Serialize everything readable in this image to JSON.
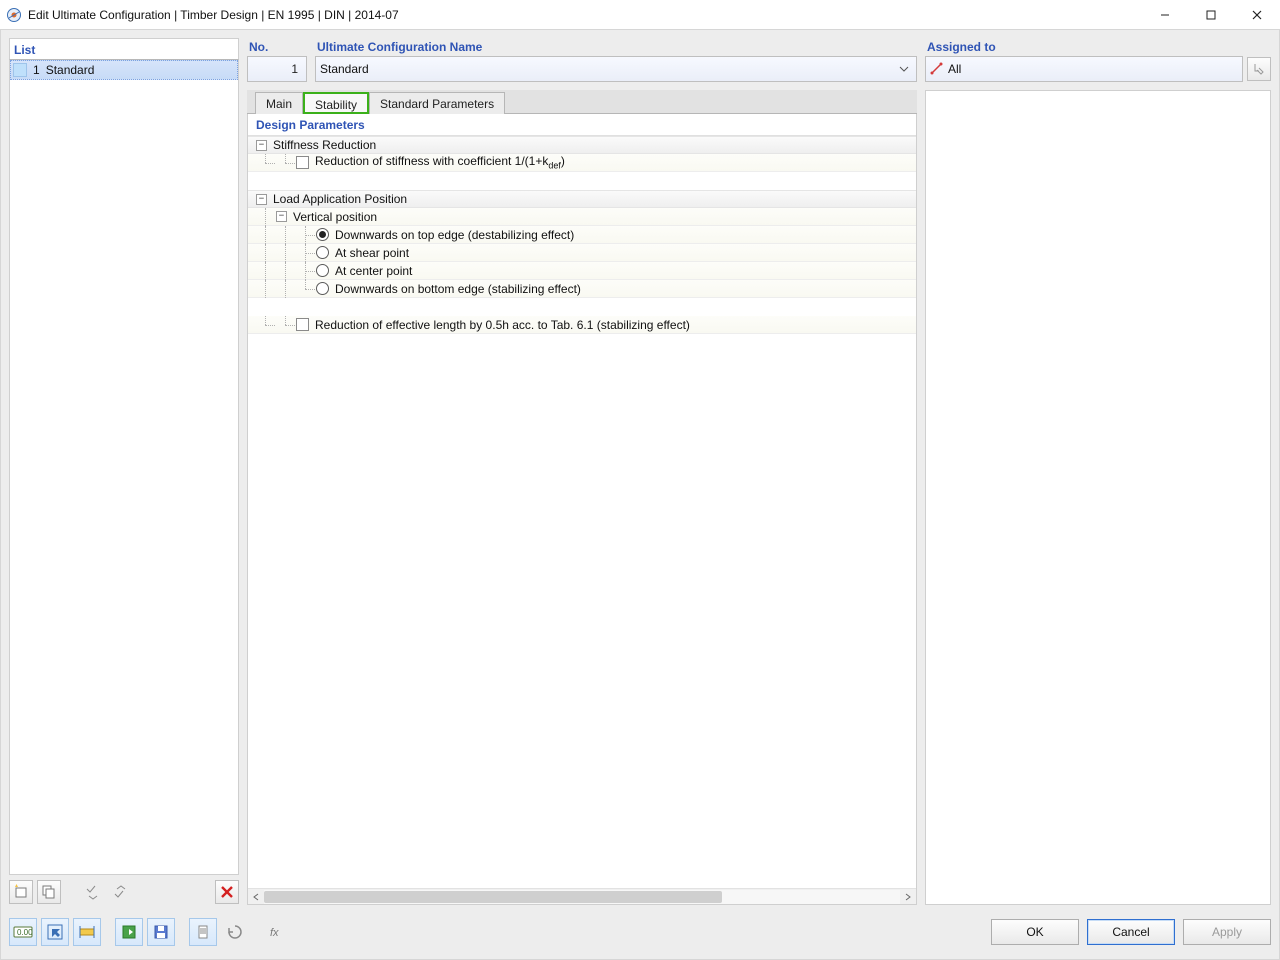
{
  "title": "Edit Ultimate Configuration | Timber Design | EN 1995 | DIN | 2014-07",
  "left": {
    "header": "List",
    "item_no": "1",
    "item_name": "Standard"
  },
  "fields": {
    "no_label": "No.",
    "no_value": "1",
    "name_label": "Ultimate Configuration Name",
    "name_value": "Standard",
    "assigned_label": "Assigned to",
    "assigned_value": "All"
  },
  "tabs": {
    "main": "Main",
    "stability": "Stability",
    "stdparams": "Standard Parameters"
  },
  "params": {
    "heading": "Design Parameters",
    "stiffness_section": "Stiffness Reduction",
    "stiffness_row_pre": "Reduction of stiffness with coefficient 1/(1+k",
    "stiffness_row_sub": "def",
    "stiffness_row_post": ")",
    "load_section": "Load Application Position",
    "vertical_label": "Vertical position",
    "opt1": "Downwards on top edge (destabilizing effect)",
    "opt2": "At shear point",
    "opt3": "At center point",
    "opt4": "Downwards on bottom edge (stabilizing effect)",
    "reduce_len": "Reduction of effective length by 0.5h acc. to Tab. 6.1 (stabilizing effect)"
  },
  "buttons": {
    "ok": "OK",
    "cancel": "Cancel",
    "apply": "Apply"
  }
}
